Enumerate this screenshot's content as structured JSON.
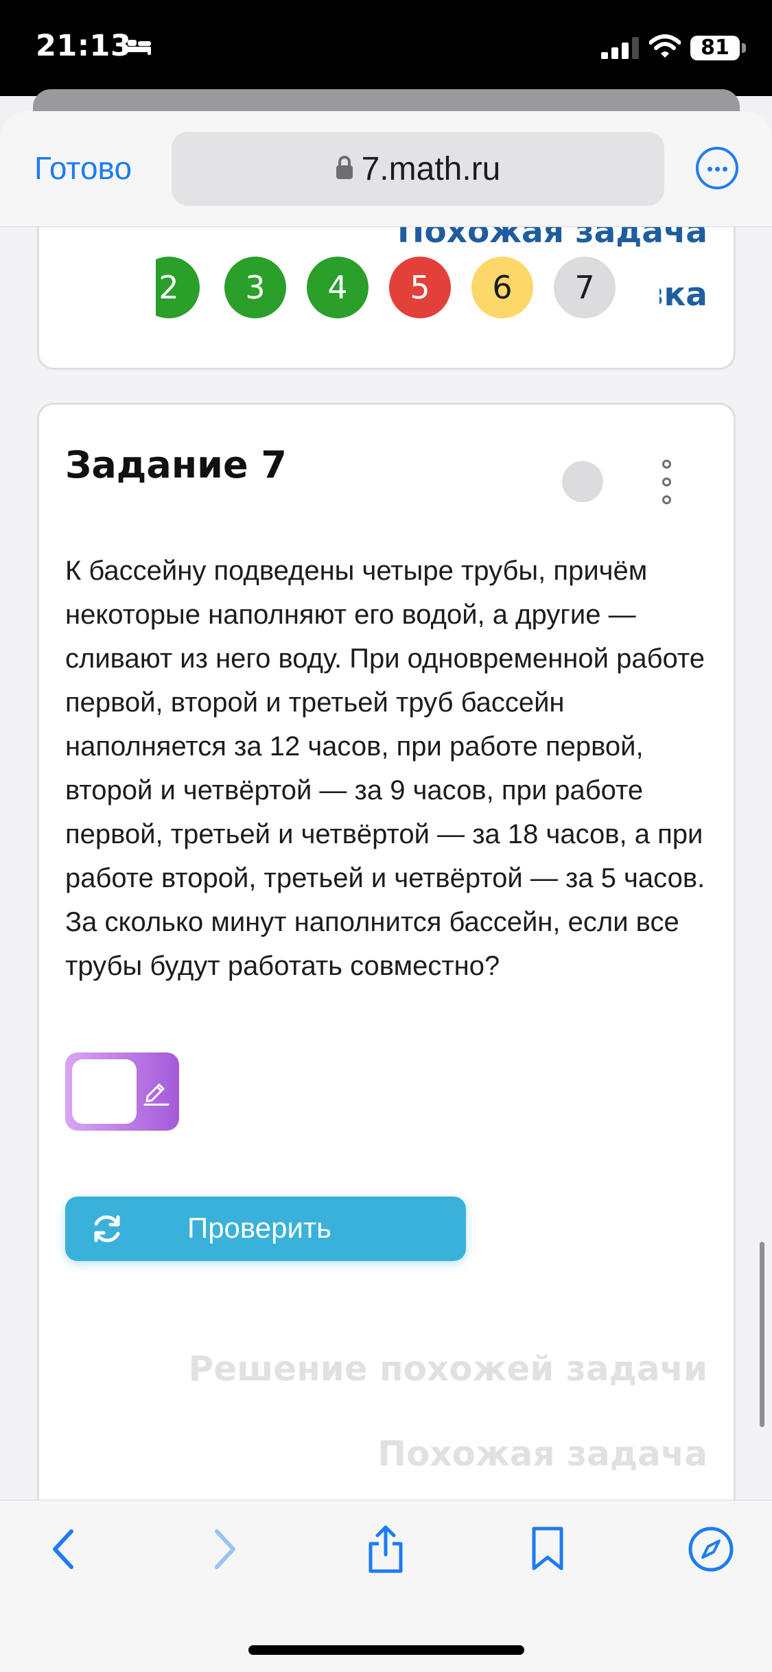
{
  "status_bar": {
    "time": "21:13",
    "battery": "81",
    "icons": [
      "bed-icon",
      "signal-icon",
      "wifi-icon",
      "battery-icon"
    ]
  },
  "browser": {
    "done_label": "Готово",
    "url": "7.math.ru",
    "icons": [
      "lock-icon",
      "more-icon"
    ]
  },
  "prev_card": {
    "similar_task": "Похожая задача",
    "hint": "зка",
    "task_numbers": [
      {
        "label": "2",
        "status": "correct"
      },
      {
        "label": "3",
        "status": "correct"
      },
      {
        "label": "4",
        "status": "correct"
      },
      {
        "label": "5",
        "status": "wrong"
      },
      {
        "label": "6",
        "status": "partial"
      },
      {
        "label": "7",
        "status": "unsolved"
      }
    ]
  },
  "task": {
    "title": "Задание 7",
    "text": "К бассейну подведены четыре трубы, причём некоторые наполняют его водой, а другие — сливают из него воду. При одновременной работе первой, второй и третьей труб бассейн наполняется за 12 часов, при работе первой, второй и четвёртой — за 9 часов, при работе первой, третьей и четвёртой — за 18 часов, а при работе второй, третьей и четвёртой — за 5 часов. За сколько минут наполнится бассейн, если все трубы будут работать совместно?",
    "answer_value": "",
    "check_label": "Проверить",
    "solution_link": "Решение похожей задачи",
    "similar_link": "Похожая задача"
  },
  "colors": {
    "accent": "#1e7cf0",
    "link": "#1f5d9e",
    "correct": "#2a9f2a",
    "wrong": "#e4403a",
    "partial": "#fcd86a",
    "unsolved": "#dcdcdf",
    "check_button": "#3ab1da"
  },
  "toolbar": {
    "items": [
      "back-icon",
      "forward-icon",
      "share-icon",
      "bookmarks-icon",
      "compass-icon"
    ]
  }
}
